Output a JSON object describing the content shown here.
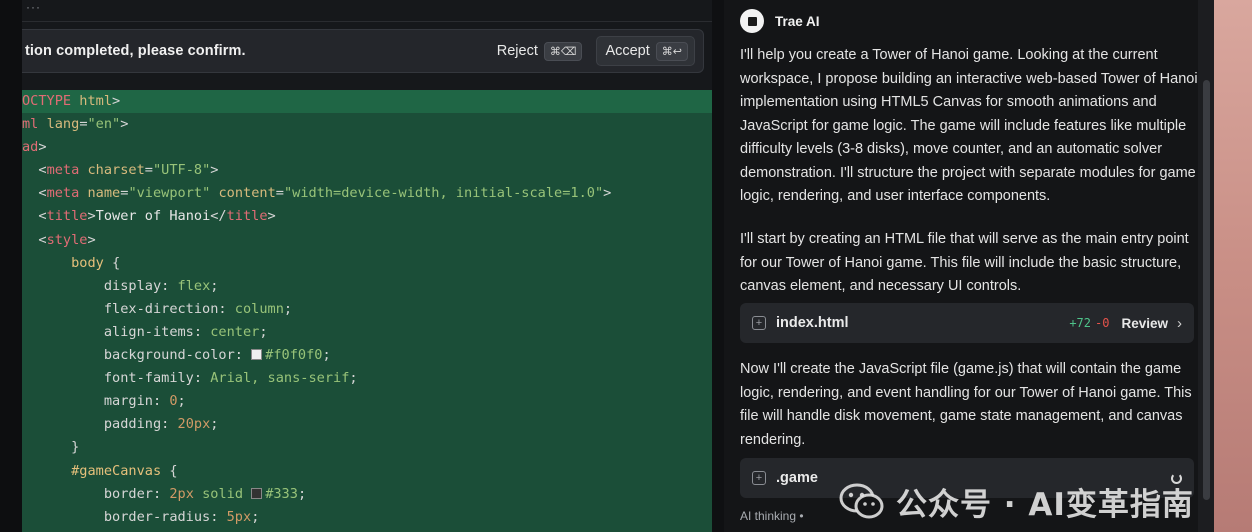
{
  "editor": {
    "topbar_dots": "···",
    "confirm": {
      "text": "tion completed, please confirm.",
      "reject_label": "Reject",
      "reject_shortcut": "⌘⌫",
      "accept_label": "Accept",
      "accept_shortcut": "⌘↩"
    },
    "code_lines": [
      "OCTYPE html>",
      "ml lang=\"en\">",
      "ad>",
      "  <meta charset=\"UTF-8\">",
      "  <meta name=\"viewport\" content=\"width=device-width, initial-scale=1.0\">",
      "  <title>Tower of Hanoi</title>",
      "  <style>",
      "      body {",
      "          display: flex;",
      "          flex-direction: column;",
      "          align-items: center;",
      "          background-color: #f0f0f0;",
      "          font-family: Arial, sans-serif;",
      "          margin: 0;",
      "          padding: 20px;",
      "      }",
      "      #gameCanvas {",
      "          border: 2px solid #333;",
      "          border-radius: 5px;"
    ],
    "swatch_colors": {
      "f0f0f0": "#f0f0f0",
      "333": "#333333"
    }
  },
  "chat": {
    "title": "Trae AI",
    "paragraphs": [
      "I'll help you create a Tower of Hanoi game. Looking at the current workspace, I propose building an interactive web-based Tower of Hanoi implementation using HTML5 Canvas for smooth animations and JavaScript for game logic. The game will include features like multiple difficulty levels (3-8 disks), move counter, and an automatic solver demonstration. I'll structure the project with separate modules for game logic, rendering, and user interface components.",
      "I'll start by creating an HTML file that will serve as the main entry point for our Tower of Hanoi game. This file will include the basic structure, canvas element, and necessary UI controls.",
      "Now I'll create the JavaScript file (game.js) that will contain the game logic, rendering, and event handling for our Tower of Hanoi game. This file will handle disk movement, game state management, and canvas rendering."
    ],
    "file_cards": [
      {
        "name": "index.html",
        "added": "+72",
        "removed": "-0",
        "action": "Review"
      },
      {
        "name": ".game"
      }
    ],
    "status": "AI thinking •"
  },
  "watermark": {
    "text": "公众号 · AI变革指南"
  }
}
